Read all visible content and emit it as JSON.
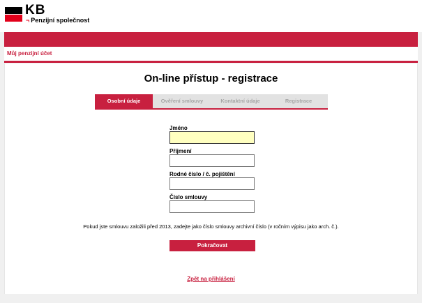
{
  "brand": {
    "logo_text": "KB",
    "subtitle": "Penzijní společnost",
    "accent_color": "#c8203f"
  },
  "nav": {
    "account_link": "Můj penzijní účet"
  },
  "page": {
    "title": "On-line přístup - registrace"
  },
  "steps": [
    {
      "label": "Osobní údaje",
      "active": true
    },
    {
      "label": "Ověření smlouvy",
      "active": false
    },
    {
      "label": "Kontaktní údaje",
      "active": false
    },
    {
      "label": "Registrace",
      "active": false
    }
  ],
  "form": {
    "fields": [
      {
        "label": "Jméno",
        "value": "",
        "focused": true
      },
      {
        "label": "Příjmení",
        "value": "",
        "focused": false
      },
      {
        "label": "Rodné číslo / č. pojištění",
        "value": "",
        "focused": false
      },
      {
        "label": "Číslo smlouvy",
        "value": "",
        "focused": false
      }
    ],
    "note": "Pokud jste smlouvu založili před 2013, zadejte jako číslo smlouvy archivní číslo (v ročním výpisu jako arch. č.).",
    "submit_label": "Pokračovat",
    "back_link": "Zpět na přihlášení"
  }
}
